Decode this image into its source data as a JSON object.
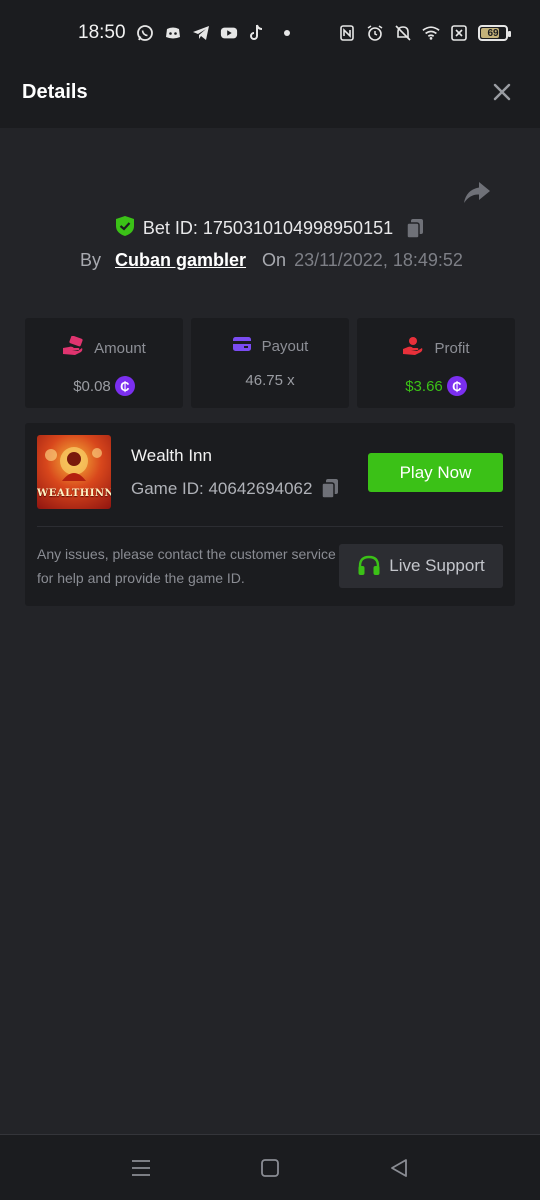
{
  "status_bar": {
    "time": "18:50",
    "battery": "69"
  },
  "header": {
    "title": "Details"
  },
  "bet": {
    "id_label": "Bet ID: 1750310104998950151",
    "by_label": "By",
    "username": "Cuban gambler",
    "on_label": "On",
    "date": "23/11/2022, 18:49:52"
  },
  "stats": [
    {
      "label": "Amount",
      "value": "$0.08",
      "icon": "amount-hand-icon"
    },
    {
      "label": "Payout",
      "value": "46.75 x",
      "icon": "wallet-card-icon"
    },
    {
      "label": "Profit",
      "value": "$3.66",
      "icon": "profit-hand-icon"
    }
  ],
  "coin_symbol": "₵",
  "game": {
    "name": "Wealth Inn",
    "id_label": "Game ID: 40642694062",
    "thumb_text": "WEALTHINN",
    "play_label": "Play Now",
    "issue_text": "Any issues, please contact the customer service for help and provide the game ID.",
    "support_label": "Live Support"
  },
  "colors": {
    "accent_green": "#3bc117",
    "coin_purple": "#7b2ff0",
    "verified_green": "#3bc117",
    "amount_pink": "#e0346f",
    "payout_purple": "#7b4cf2",
    "profit_red": "#e8303a"
  }
}
